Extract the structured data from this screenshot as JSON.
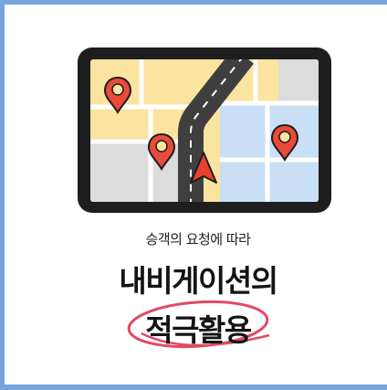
{
  "subtitle": "승객의 요청에 따라",
  "title_line1": "내비게이션의",
  "title_line2": "적극활용",
  "colors": {
    "frame": "#78a4dc",
    "tablet": "#1e1e1e",
    "map_yellow": "#fbe3a0",
    "map_gray": "#dcdcdc",
    "map_blue": "#c9dff5",
    "road": "#3f3f3f",
    "pin": "#ea4a3a",
    "arrow": "#e8412e",
    "circle": "#e14a64"
  },
  "icons": [
    "tablet-map-illustration",
    "map-pin-icon",
    "navigation-arrow-icon"
  ]
}
